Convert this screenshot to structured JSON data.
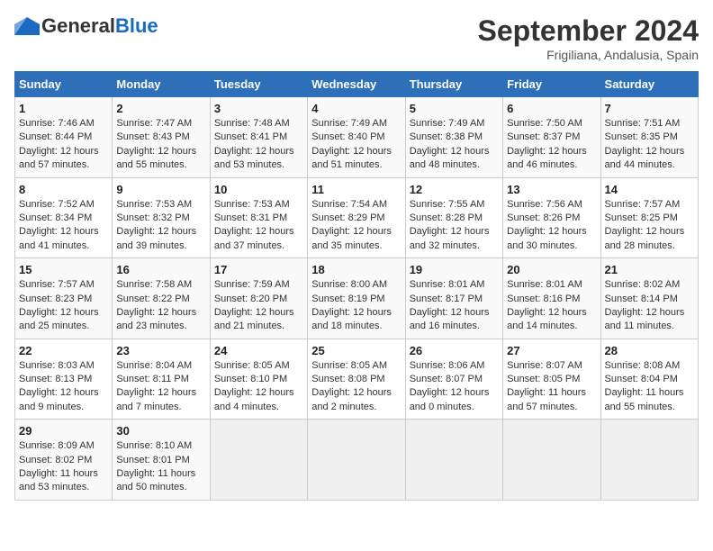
{
  "header": {
    "logo_general": "General",
    "logo_blue": "Blue",
    "month_title": "September 2024",
    "subtitle": "Frigiliana, Andalusia, Spain"
  },
  "weekdays": [
    "Sunday",
    "Monday",
    "Tuesday",
    "Wednesday",
    "Thursday",
    "Friday",
    "Saturday"
  ],
  "weeks": [
    [
      {
        "day": "1",
        "sunrise": "Sunrise: 7:46 AM",
        "sunset": "Sunset: 8:44 PM",
        "daylight": "Daylight: 12 hours and 57 minutes."
      },
      {
        "day": "2",
        "sunrise": "Sunrise: 7:47 AM",
        "sunset": "Sunset: 8:43 PM",
        "daylight": "Daylight: 12 hours and 55 minutes."
      },
      {
        "day": "3",
        "sunrise": "Sunrise: 7:48 AM",
        "sunset": "Sunset: 8:41 PM",
        "daylight": "Daylight: 12 hours and 53 minutes."
      },
      {
        "day": "4",
        "sunrise": "Sunrise: 7:49 AM",
        "sunset": "Sunset: 8:40 PM",
        "daylight": "Daylight: 12 hours and 51 minutes."
      },
      {
        "day": "5",
        "sunrise": "Sunrise: 7:49 AM",
        "sunset": "Sunset: 8:38 PM",
        "daylight": "Daylight: 12 hours and 48 minutes."
      },
      {
        "day": "6",
        "sunrise": "Sunrise: 7:50 AM",
        "sunset": "Sunset: 8:37 PM",
        "daylight": "Daylight: 12 hours and 46 minutes."
      },
      {
        "day": "7",
        "sunrise": "Sunrise: 7:51 AM",
        "sunset": "Sunset: 8:35 PM",
        "daylight": "Daylight: 12 hours and 44 minutes."
      }
    ],
    [
      {
        "day": "8",
        "sunrise": "Sunrise: 7:52 AM",
        "sunset": "Sunset: 8:34 PM",
        "daylight": "Daylight: 12 hours and 41 minutes."
      },
      {
        "day": "9",
        "sunrise": "Sunrise: 7:53 AM",
        "sunset": "Sunset: 8:32 PM",
        "daylight": "Daylight: 12 hours and 39 minutes."
      },
      {
        "day": "10",
        "sunrise": "Sunrise: 7:53 AM",
        "sunset": "Sunset: 8:31 PM",
        "daylight": "Daylight: 12 hours and 37 minutes."
      },
      {
        "day": "11",
        "sunrise": "Sunrise: 7:54 AM",
        "sunset": "Sunset: 8:29 PM",
        "daylight": "Daylight: 12 hours and 35 minutes."
      },
      {
        "day": "12",
        "sunrise": "Sunrise: 7:55 AM",
        "sunset": "Sunset: 8:28 PM",
        "daylight": "Daylight: 12 hours and 32 minutes."
      },
      {
        "day": "13",
        "sunrise": "Sunrise: 7:56 AM",
        "sunset": "Sunset: 8:26 PM",
        "daylight": "Daylight: 12 hours and 30 minutes."
      },
      {
        "day": "14",
        "sunrise": "Sunrise: 7:57 AM",
        "sunset": "Sunset: 8:25 PM",
        "daylight": "Daylight: 12 hours and 28 minutes."
      }
    ],
    [
      {
        "day": "15",
        "sunrise": "Sunrise: 7:57 AM",
        "sunset": "Sunset: 8:23 PM",
        "daylight": "Daylight: 12 hours and 25 minutes."
      },
      {
        "day": "16",
        "sunrise": "Sunrise: 7:58 AM",
        "sunset": "Sunset: 8:22 PM",
        "daylight": "Daylight: 12 hours and 23 minutes."
      },
      {
        "day": "17",
        "sunrise": "Sunrise: 7:59 AM",
        "sunset": "Sunset: 8:20 PM",
        "daylight": "Daylight: 12 hours and 21 minutes."
      },
      {
        "day": "18",
        "sunrise": "Sunrise: 8:00 AM",
        "sunset": "Sunset: 8:19 PM",
        "daylight": "Daylight: 12 hours and 18 minutes."
      },
      {
        "day": "19",
        "sunrise": "Sunrise: 8:01 AM",
        "sunset": "Sunset: 8:17 PM",
        "daylight": "Daylight: 12 hours and 16 minutes."
      },
      {
        "day": "20",
        "sunrise": "Sunrise: 8:01 AM",
        "sunset": "Sunset: 8:16 PM",
        "daylight": "Daylight: 12 hours and 14 minutes."
      },
      {
        "day": "21",
        "sunrise": "Sunrise: 8:02 AM",
        "sunset": "Sunset: 8:14 PM",
        "daylight": "Daylight: 12 hours and 11 minutes."
      }
    ],
    [
      {
        "day": "22",
        "sunrise": "Sunrise: 8:03 AM",
        "sunset": "Sunset: 8:13 PM",
        "daylight": "Daylight: 12 hours and 9 minutes."
      },
      {
        "day": "23",
        "sunrise": "Sunrise: 8:04 AM",
        "sunset": "Sunset: 8:11 PM",
        "daylight": "Daylight: 12 hours and 7 minutes."
      },
      {
        "day": "24",
        "sunrise": "Sunrise: 8:05 AM",
        "sunset": "Sunset: 8:10 PM",
        "daylight": "Daylight: 12 hours and 4 minutes."
      },
      {
        "day": "25",
        "sunrise": "Sunrise: 8:05 AM",
        "sunset": "Sunset: 8:08 PM",
        "daylight": "Daylight: 12 hours and 2 minutes."
      },
      {
        "day": "26",
        "sunrise": "Sunrise: 8:06 AM",
        "sunset": "Sunset: 8:07 PM",
        "daylight": "Daylight: 12 hours and 0 minutes."
      },
      {
        "day": "27",
        "sunrise": "Sunrise: 8:07 AM",
        "sunset": "Sunset: 8:05 PM",
        "daylight": "Daylight: 11 hours and 57 minutes."
      },
      {
        "day": "28",
        "sunrise": "Sunrise: 8:08 AM",
        "sunset": "Sunset: 8:04 PM",
        "daylight": "Daylight: 11 hours and 55 minutes."
      }
    ],
    [
      {
        "day": "29",
        "sunrise": "Sunrise: 8:09 AM",
        "sunset": "Sunset: 8:02 PM",
        "daylight": "Daylight: 11 hours and 53 minutes."
      },
      {
        "day": "30",
        "sunrise": "Sunrise: 8:10 AM",
        "sunset": "Sunset: 8:01 PM",
        "daylight": "Daylight: 11 hours and 50 minutes."
      },
      null,
      null,
      null,
      null,
      null
    ]
  ]
}
